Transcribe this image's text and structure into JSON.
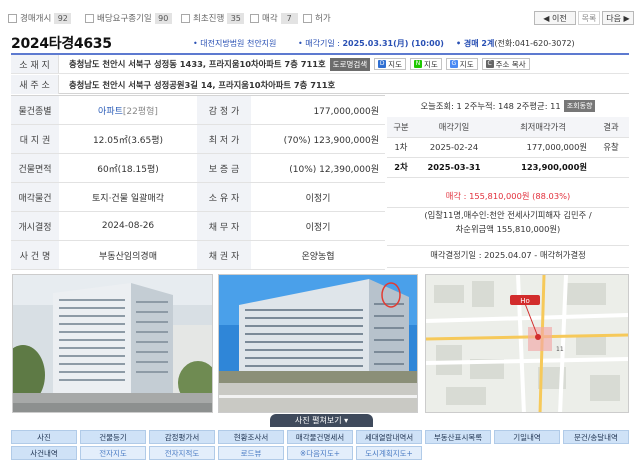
{
  "status_bar": {
    "stages": [
      {
        "label": "경매개시",
        "count": "92"
      },
      {
        "label": "배당요구종기일",
        "count": "90"
      },
      {
        "label": "최초진행",
        "count": "35"
      },
      {
        "label": "매각",
        "count": "7"
      },
      {
        "label": "허가",
        "count": ""
      }
    ],
    "prev_label": "◀ 이전",
    "list_label": "목록",
    "next_label": "다음 ▶"
  },
  "header": {
    "case_number": "2024타경4635",
    "court": "• 대전지방법원 천안지원",
    "sale_date_label": "• 매각기일 : ",
    "sale_date_value": "2025.03.31(月) (10:00)",
    "division_label": "• 경매 2계",
    "division_phone": "(전화:041-620-3072)"
  },
  "address": {
    "lot_label": "소 재 지",
    "lot_address": "충청남도 천안시 서북구 성정동 1433, 프라지움10차아파트 7층 711호",
    "road_search_label": "도로명검색",
    "map_buttons": [
      {
        "label": "지도",
        "icon": "D",
        "color": "#2f6fd1"
      },
      {
        "label": "지도",
        "icon": "N",
        "color": "#1ec800"
      },
      {
        "label": "지도",
        "icon": "G",
        "color": "#4a8af4"
      },
      {
        "label": "주소 복사",
        "icon": "C",
        "color": "#666666"
      }
    ],
    "road_label": "새 주 소",
    "road_address": "충청남도 천안시 서북구 성정공원3길 14, 프라지움10차아파트 7층 711호"
  },
  "info_rows": [
    {
      "l1": "물건종별",
      "v1_main": "아파트",
      "v1_sub": "[22평형]",
      "l2": "감 정 가",
      "v2": "177,000,000원",
      "v2_align": "right"
    },
    {
      "l1": "대 지 권",
      "v1": "12.05㎡(3.65평)",
      "l2": "최 저 가",
      "v2": "(70%) 123,900,000원",
      "v2_align": "right"
    },
    {
      "l1": "건물면적",
      "v1": "60㎡(18.15평)",
      "l2": "보 증 금",
      "v2": "(10%) 12,390,000원",
      "v2_align": "right"
    },
    {
      "l1": "매각물건",
      "v1": "토지·건물 일괄매각",
      "l2": "소 유 자",
      "v2": "이정기",
      "v2_align": "center"
    },
    {
      "l1": "개시결정",
      "v1": "2024-08-26",
      "l2": "채 무 자",
      "v2": "이정기",
      "v2_align": "center"
    },
    {
      "l1": "사 건 명",
      "v1": "부동산임의경매",
      "l2": "채 권 자",
      "v2": "온양농협",
      "v2_align": "center"
    }
  ],
  "views": {
    "text": "오늘조회: 1  2주누적: 148  2주평균: 11",
    "stats_label": "조회동향"
  },
  "history": {
    "headers": [
      "구분",
      "매각기일",
      "최저매각가격",
      "결과"
    ],
    "rows": [
      {
        "round": "1차",
        "date": "2025-02-24",
        "price": "177,000,000원",
        "result": "유찰"
      },
      {
        "round": "2차",
        "date": "2025-03-31",
        "price": "123,900,000원",
        "result": ""
      }
    ]
  },
  "sale_price": "매각 : 155,810,000원 (88.03%)",
  "winner_line1": "(입찰11명,매수인:천안 전세사기피해자 김민주 /",
  "winner_line2": "차순위금액 155,810,000원)",
  "decision": "매각결정기일 : 2025.04.07 - 매각허가결정",
  "photo_toggle_label": "사진 펼쳐보기",
  "map_photo": {
    "marker_label": "Ho",
    "road_label": "11"
  },
  "doc_buttons_row1": [
    "사진",
    "건물등기",
    "감정평가서",
    "현황조사서",
    "매각물건명세서",
    "세대열람내역서",
    "부동산표시목록",
    "기일내역",
    "문건/송달내역"
  ],
  "doc_buttons_row2": [
    "사건내역",
    "전자지도",
    "전자지적도",
    "로드뷰",
    "※다음지도+",
    "도시계획지도+"
  ]
}
